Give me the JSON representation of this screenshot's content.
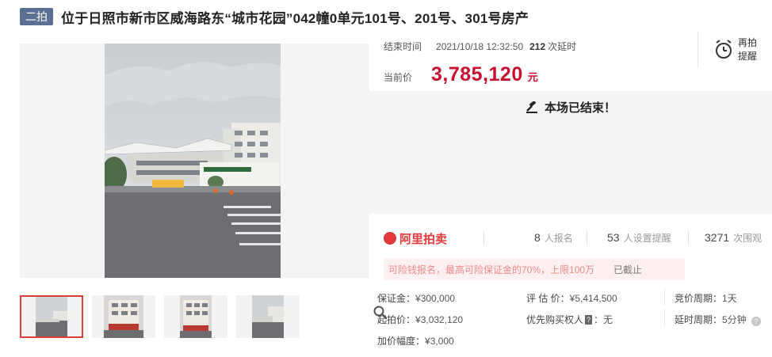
{
  "title_bar": {
    "round_badge": "二拍",
    "title": "位于日照市新市区威海路东“城市花园”042幢0单元101号、201号、301号房产"
  },
  "gallery": {
    "thumbnail_count": 4,
    "selected_index": 0
  },
  "auction": {
    "end_time_label": "结束时间",
    "end_time": "2021/10/18 12:32:50",
    "delay_count": "212",
    "delay_unit": "次延时",
    "remind_label": "再拍提醒",
    "current_price_label": "当前价",
    "current_price": "3,785,120",
    "currency_unit": "元",
    "ended_message": "本场已结束！"
  },
  "stats": {
    "platform_name": "阿里拍卖",
    "signups": "8",
    "signups_label": "人报名",
    "reminders": "53",
    "reminders_label": "人设置提醒",
    "watchers": "3271",
    "watchers_label": "次围观"
  },
  "notice": {
    "text": "可险钱报名，最高可险保证金的70%，上限100万",
    "status": "已截止"
  },
  "details": {
    "deposit_label": "保证金：",
    "deposit": "¥300,000",
    "appraisal_label": "评 估 价：",
    "appraisal": "¥5,414,500",
    "cycle_label": "竞价周期：",
    "cycle": "1天",
    "start_price_label": "起拍价：",
    "start_price": "¥3,032,120",
    "priority_label": "优先购买权人",
    "priority_badge": "?",
    "priority_value": "无",
    "delay_period_label": "延时周期：",
    "delay_period": "5分钟",
    "increment_label": "加价幅度：",
    "increment": "¥3,000"
  },
  "colors": {
    "accent_red": "#c8102e",
    "badge_blue": "#5a6f91",
    "ali_red": "#e4393c"
  }
}
